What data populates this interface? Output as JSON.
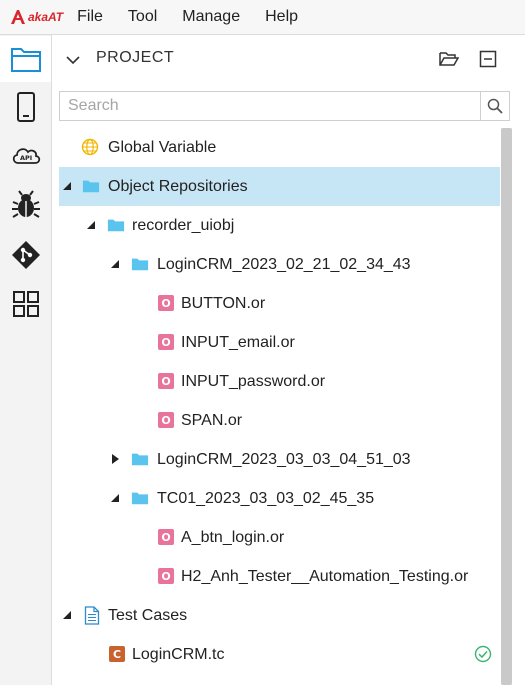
{
  "app": {
    "logo_text": "akaAT",
    "logo_prefix": "aka",
    "logo_suffix": "AT"
  },
  "menu": [
    "File",
    "Tool",
    "Manage",
    "Help"
  ],
  "activity_bar": [
    {
      "icon": "folder-icon",
      "active": true
    },
    {
      "icon": "mobile-device-icon",
      "active": false
    },
    {
      "icon": "api-cloud-icon",
      "active": false
    },
    {
      "icon": "bug-icon",
      "active": false
    },
    {
      "icon": "git-icon",
      "active": false
    },
    {
      "icon": "grid-apps-icon",
      "active": false
    }
  ],
  "panel": {
    "title": "PROJECT",
    "search_placeholder": "Search"
  },
  "tree": [
    {
      "label": "Global Variable",
      "icon": "globe-icon",
      "level": 0,
      "toggle": "none",
      "selected": false
    },
    {
      "label": "Object Repositories",
      "icon": "folder-icon",
      "level": 0,
      "toggle": "expanded",
      "selected": true
    },
    {
      "label": "recorder_uiobj",
      "icon": "folder-icon",
      "level": 1,
      "toggle": "expanded",
      "selected": false
    },
    {
      "label": "LoginCRM_2023_02_21_02_34_43",
      "icon": "folder-icon",
      "level": 2,
      "toggle": "expanded",
      "selected": false
    },
    {
      "label": "BUTTON.or",
      "icon": "object-file-icon",
      "level": 3,
      "toggle": "none",
      "selected": false
    },
    {
      "label": "INPUT_email.or",
      "icon": "object-file-icon",
      "level": 3,
      "toggle": "none",
      "selected": false
    },
    {
      "label": "INPUT_password.or",
      "icon": "object-file-icon",
      "level": 3,
      "toggle": "none",
      "selected": false
    },
    {
      "label": "SPAN.or",
      "icon": "object-file-icon",
      "level": 3,
      "toggle": "none",
      "selected": false
    },
    {
      "label": "LoginCRM_2023_03_03_04_51_03",
      "icon": "folder-icon",
      "level": 2,
      "toggle": "collapsed",
      "selected": false
    },
    {
      "label": "TC01_2023_03_03_02_45_35",
      "icon": "folder-icon",
      "level": 2,
      "toggle": "expanded",
      "selected": false
    },
    {
      "label": "A_btn_login.or",
      "icon": "object-file-icon",
      "level": 3,
      "toggle": "none",
      "selected": false
    },
    {
      "label": "H2_Anh_Tester__Automation_Testing.or",
      "icon": "object-file-icon",
      "level": 3,
      "toggle": "none",
      "selected": false
    },
    {
      "label": "Test Cases",
      "icon": "document-icon",
      "level": 0,
      "toggle": "expanded",
      "selected": false
    },
    {
      "label": "LoginCRM.tc",
      "icon": "test-case-file-icon",
      "level": 1,
      "toggle": "none",
      "selected": false,
      "status": "passed"
    }
  ],
  "badges": {
    "object": "O",
    "test_case": "C"
  },
  "colors": {
    "accent_red": "#d8262c",
    "folder_blue": "#5bc4ee",
    "selected_row": "#c7e6f5",
    "object_badge": "#e8739b",
    "test_case_badge": "#c8622e",
    "status_passed": "#3cb371",
    "globe": "#f2b600"
  }
}
